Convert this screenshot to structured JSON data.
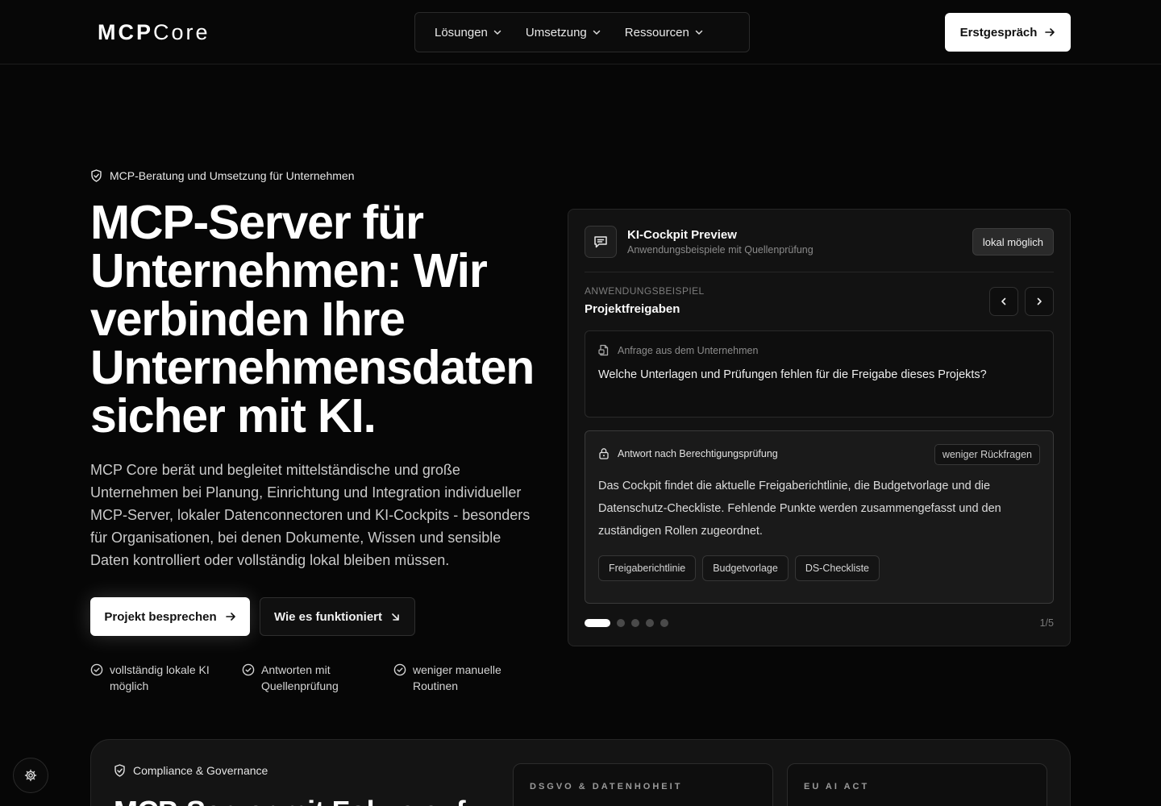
{
  "header": {
    "logo_bold": "MCP",
    "logo_light": "Core",
    "nav": [
      {
        "label": "Lösungen"
      },
      {
        "label": "Umsetzung"
      },
      {
        "label": "Ressourcen"
      }
    ],
    "cta_label": "Erstgespräch"
  },
  "hero": {
    "eyebrow": "MCP-Beratung und Umsetzung für Unternehmen",
    "title": "MCP-Server für Unternehmen: Wir verbinden Ihre Unternehmensdaten sicher mit KI.",
    "description": "MCP Core berät und begleitet mittelständische und große Unternehmen bei Planung, Einrichtung und Integration individueller MCP-Server, lokaler Datenconnectoren und KI-Cockpits - besonders für Organisationen, bei denen Dokumente, Wissen und sensible Daten kontrolliert oder vollständig lokal bleiben müssen.",
    "primary_button": "Projekt besprechen",
    "secondary_button": "Wie es funktioniert",
    "features": [
      {
        "label": "vollständig lokale KI möglich"
      },
      {
        "label": "Antworten mit Quellenprüfung"
      },
      {
        "label": "weniger manuelle Routinen"
      }
    ]
  },
  "cockpit": {
    "title": "KI-Cockpit Preview",
    "subtitle": "Anwendungsbeispiele mit Quellenprüfung",
    "badge": "lokal möglich",
    "usecase_label": "ANWENDUNGSBEISPIEL",
    "usecase_title": "Projektfreigaben",
    "query_label": "Anfrage aus dem Unternehmen",
    "query_text": "Welche Unterlagen und Prüfungen fehlen für die Freigabe dieses Projekts?",
    "answer_label": "Antwort nach Berechtigungsprüfung",
    "answer_badge": "weniger Rückfragen",
    "answer_text": "Das Cockpit findet die aktuelle Freigaberichtlinie, die Budgetvorlage und die Datenschutz-Checkliste. Fehlende Punkte werden zusammengefasst und den zuständigen Rollen zugeordnet.",
    "sources": [
      {
        "label": "Freigaberichtlinie"
      },
      {
        "label": "Budgetvorlage"
      },
      {
        "label": "DS-Checkliste"
      }
    ],
    "slide_count": 5,
    "active_slide": 1,
    "counter": "1/5"
  },
  "compliance": {
    "eyebrow": "Compliance & Governance",
    "heading": "MCP-Server mit Fokus auf",
    "cards": [
      {
        "label": "DSGVO & DATENHOHEIT"
      },
      {
        "label": "EU AI ACT"
      }
    ]
  },
  "icons": {
    "shield": "shield-check-icon",
    "chevron": "chevron-down-icon",
    "arrow_right": "arrow-right-icon",
    "arrow_down_right": "arrow-down-right-icon",
    "check_circle": "check-circle-icon",
    "chat": "message-square-icon",
    "document": "file-icon",
    "lock": "lock-icon",
    "settings": "gear-icon"
  },
  "colors": {
    "background": "#060606",
    "accent": "#ffffff",
    "card": "#121212"
  }
}
